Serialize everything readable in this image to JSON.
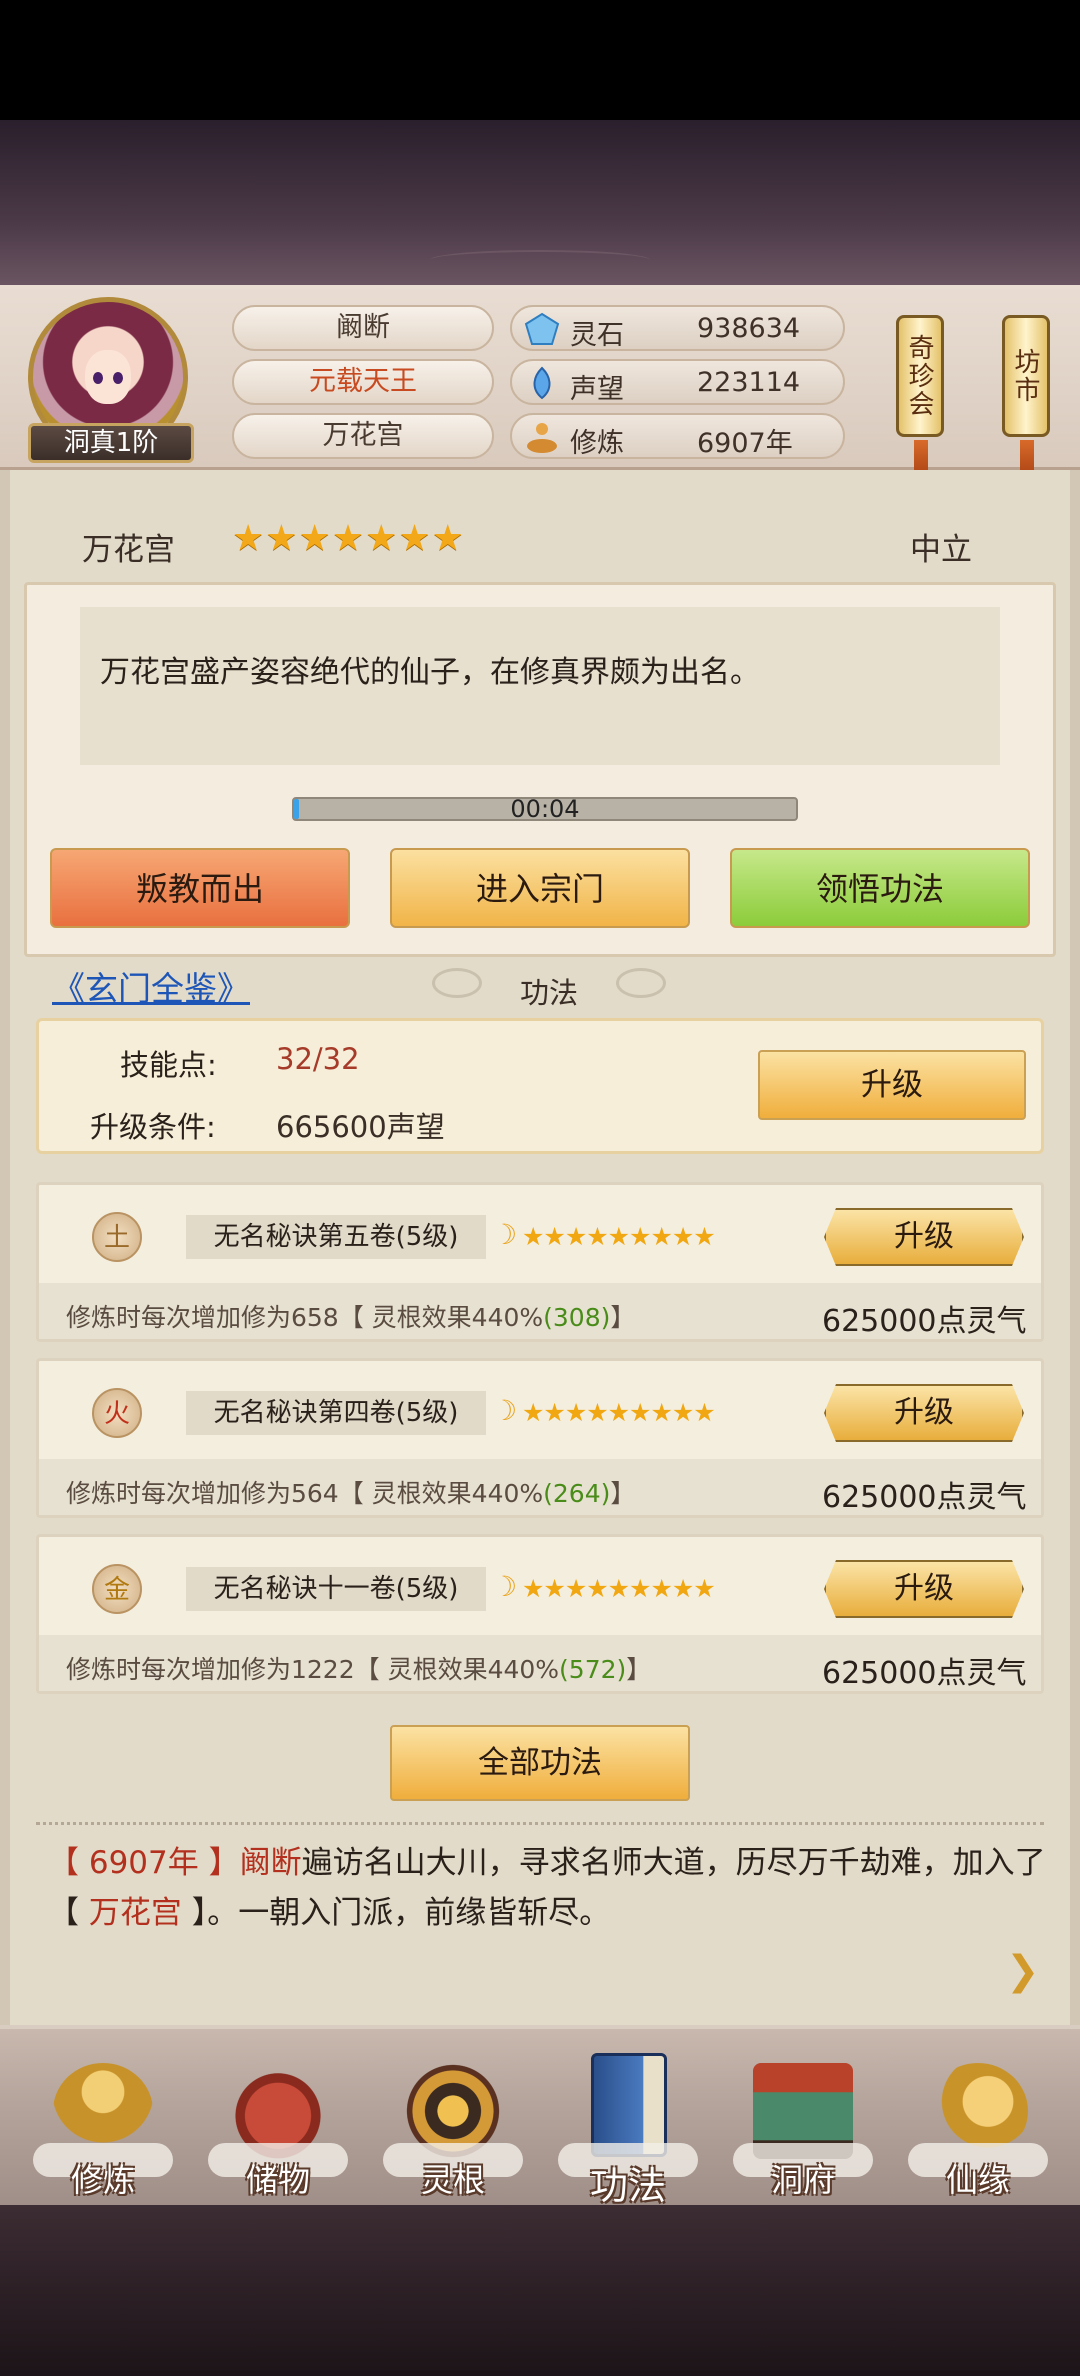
{
  "player": {
    "name": "阚断",
    "title": "元载天王",
    "sect": "万花宫",
    "rank": "洞真1阶"
  },
  "resources": [
    {
      "icon": "spirit-stone-icon",
      "label": "灵石",
      "value": "938634"
    },
    {
      "icon": "prestige-icon",
      "label": "声望",
      "value": "223114"
    },
    {
      "icon": "cultivation-icon",
      "label": "修炼",
      "value": "6907年"
    }
  ],
  "side_buttons": {
    "treasure": "奇珍会",
    "market": "坊市"
  },
  "sect_info": {
    "name": "万花宫",
    "stars": "★★★★★★★",
    "alignment": "中立",
    "description": "万花宫盛产姿容绝代的仙子，在修真界颇为出名。",
    "timer": "00:04",
    "timer_progress": 0.01
  },
  "actions": {
    "betray": "叛教而出",
    "enter": "进入宗门",
    "learn": "领悟功法"
  },
  "gongfa": {
    "link": "《玄门全鉴》",
    "title": "功法",
    "skill_points_label": "技能点:",
    "skill_points": "32/32",
    "upgrade_cond_label": "升级条件:",
    "upgrade_cond": "665600声望",
    "upgrade_label": "升级",
    "items": [
      {
        "element": "土",
        "element_color": "#9a6a2a",
        "name": "无名秘诀第五卷(5级)",
        "stars": "★★★★★★★★★",
        "effect_prefix": "修炼时每次增加修为658【 灵根效果440%",
        "effect_bonus": "(308)",
        "effect_suffix": "】",
        "cost": "625000点灵气",
        "button": "升级"
      },
      {
        "element": "火",
        "element_color": "#c0301a",
        "name": "无名秘诀第四卷(5级)",
        "stars": "★★★★★★★★★",
        "effect_prefix": "修炼时每次增加修为564【 灵根效果440%",
        "effect_bonus": "(264)",
        "effect_suffix": "】",
        "cost": "625000点灵气",
        "button": "升级"
      },
      {
        "element": "金",
        "element_color": "#b07a10",
        "name": "无名秘诀十一卷(5级)",
        "stars": "★★★★★★★★★",
        "effect_prefix": "修炼时每次增加修为1222【 灵根效果440%",
        "effect_bonus": "(572)",
        "effect_suffix": "】",
        "cost": "625000点灵气",
        "button": "升级"
      }
    ],
    "all_label": "全部功法"
  },
  "log": {
    "year": "【 6907年 】",
    "name": "阚断",
    "text1": "遍访名山大川，寻求名师大道，历尽万千劫难，加入了",
    "sect_open": "【 ",
    "sect": "万花宫",
    "sect_close": " 】",
    "text2": "。一朝入门派，前缘皆斩尽。"
  },
  "nav": [
    {
      "label": "修炼",
      "icon": "cultivate-icon"
    },
    {
      "label": "储物",
      "icon": "storage-bag-icon"
    },
    {
      "label": "灵根",
      "icon": "spirit-root-icon"
    },
    {
      "label": "功法",
      "icon": "technique-book-icon"
    },
    {
      "label": "洞府",
      "icon": "cave-house-icon"
    },
    {
      "label": "仙缘",
      "icon": "fate-icon"
    }
  ]
}
